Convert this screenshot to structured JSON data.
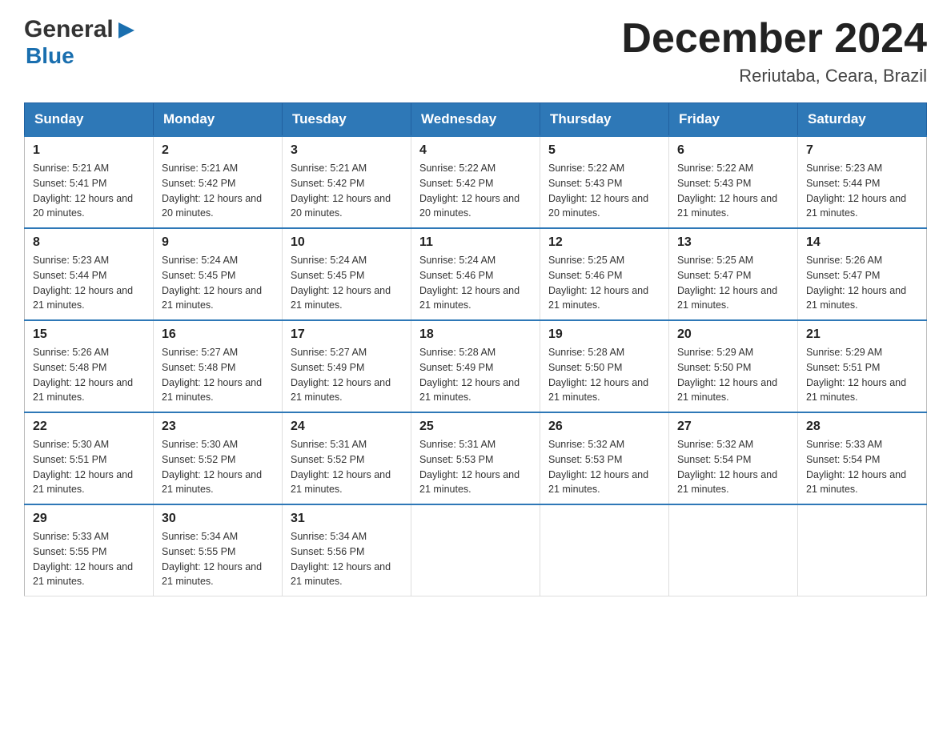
{
  "header": {
    "logo": {
      "general": "General",
      "blue": "Blue",
      "arrow_symbol": "▶"
    },
    "title": "December 2024",
    "location": "Reriutaba, Ceara, Brazil"
  },
  "calendar": {
    "days_of_week": [
      "Sunday",
      "Monday",
      "Tuesday",
      "Wednesday",
      "Thursday",
      "Friday",
      "Saturday"
    ],
    "weeks": [
      [
        {
          "day": "1",
          "sunrise": "Sunrise: 5:21 AM",
          "sunset": "Sunset: 5:41 PM",
          "daylight": "Daylight: 12 hours and 20 minutes."
        },
        {
          "day": "2",
          "sunrise": "Sunrise: 5:21 AM",
          "sunset": "Sunset: 5:42 PM",
          "daylight": "Daylight: 12 hours and 20 minutes."
        },
        {
          "day": "3",
          "sunrise": "Sunrise: 5:21 AM",
          "sunset": "Sunset: 5:42 PM",
          "daylight": "Daylight: 12 hours and 20 minutes."
        },
        {
          "day": "4",
          "sunrise": "Sunrise: 5:22 AM",
          "sunset": "Sunset: 5:42 PM",
          "daylight": "Daylight: 12 hours and 20 minutes."
        },
        {
          "day": "5",
          "sunrise": "Sunrise: 5:22 AM",
          "sunset": "Sunset: 5:43 PM",
          "daylight": "Daylight: 12 hours and 20 minutes."
        },
        {
          "day": "6",
          "sunrise": "Sunrise: 5:22 AM",
          "sunset": "Sunset: 5:43 PM",
          "daylight": "Daylight: 12 hours and 21 minutes."
        },
        {
          "day": "7",
          "sunrise": "Sunrise: 5:23 AM",
          "sunset": "Sunset: 5:44 PM",
          "daylight": "Daylight: 12 hours and 21 minutes."
        }
      ],
      [
        {
          "day": "8",
          "sunrise": "Sunrise: 5:23 AM",
          "sunset": "Sunset: 5:44 PM",
          "daylight": "Daylight: 12 hours and 21 minutes."
        },
        {
          "day": "9",
          "sunrise": "Sunrise: 5:24 AM",
          "sunset": "Sunset: 5:45 PM",
          "daylight": "Daylight: 12 hours and 21 minutes."
        },
        {
          "day": "10",
          "sunrise": "Sunrise: 5:24 AM",
          "sunset": "Sunset: 5:45 PM",
          "daylight": "Daylight: 12 hours and 21 minutes."
        },
        {
          "day": "11",
          "sunrise": "Sunrise: 5:24 AM",
          "sunset": "Sunset: 5:46 PM",
          "daylight": "Daylight: 12 hours and 21 minutes."
        },
        {
          "day": "12",
          "sunrise": "Sunrise: 5:25 AM",
          "sunset": "Sunset: 5:46 PM",
          "daylight": "Daylight: 12 hours and 21 minutes."
        },
        {
          "day": "13",
          "sunrise": "Sunrise: 5:25 AM",
          "sunset": "Sunset: 5:47 PM",
          "daylight": "Daylight: 12 hours and 21 minutes."
        },
        {
          "day": "14",
          "sunrise": "Sunrise: 5:26 AM",
          "sunset": "Sunset: 5:47 PM",
          "daylight": "Daylight: 12 hours and 21 minutes."
        }
      ],
      [
        {
          "day": "15",
          "sunrise": "Sunrise: 5:26 AM",
          "sunset": "Sunset: 5:48 PM",
          "daylight": "Daylight: 12 hours and 21 minutes."
        },
        {
          "day": "16",
          "sunrise": "Sunrise: 5:27 AM",
          "sunset": "Sunset: 5:48 PM",
          "daylight": "Daylight: 12 hours and 21 minutes."
        },
        {
          "day": "17",
          "sunrise": "Sunrise: 5:27 AM",
          "sunset": "Sunset: 5:49 PM",
          "daylight": "Daylight: 12 hours and 21 minutes."
        },
        {
          "day": "18",
          "sunrise": "Sunrise: 5:28 AM",
          "sunset": "Sunset: 5:49 PM",
          "daylight": "Daylight: 12 hours and 21 minutes."
        },
        {
          "day": "19",
          "sunrise": "Sunrise: 5:28 AM",
          "sunset": "Sunset: 5:50 PM",
          "daylight": "Daylight: 12 hours and 21 minutes."
        },
        {
          "day": "20",
          "sunrise": "Sunrise: 5:29 AM",
          "sunset": "Sunset: 5:50 PM",
          "daylight": "Daylight: 12 hours and 21 minutes."
        },
        {
          "day": "21",
          "sunrise": "Sunrise: 5:29 AM",
          "sunset": "Sunset: 5:51 PM",
          "daylight": "Daylight: 12 hours and 21 minutes."
        }
      ],
      [
        {
          "day": "22",
          "sunrise": "Sunrise: 5:30 AM",
          "sunset": "Sunset: 5:51 PM",
          "daylight": "Daylight: 12 hours and 21 minutes."
        },
        {
          "day": "23",
          "sunrise": "Sunrise: 5:30 AM",
          "sunset": "Sunset: 5:52 PM",
          "daylight": "Daylight: 12 hours and 21 minutes."
        },
        {
          "day": "24",
          "sunrise": "Sunrise: 5:31 AM",
          "sunset": "Sunset: 5:52 PM",
          "daylight": "Daylight: 12 hours and 21 minutes."
        },
        {
          "day": "25",
          "sunrise": "Sunrise: 5:31 AM",
          "sunset": "Sunset: 5:53 PM",
          "daylight": "Daylight: 12 hours and 21 minutes."
        },
        {
          "day": "26",
          "sunrise": "Sunrise: 5:32 AM",
          "sunset": "Sunset: 5:53 PM",
          "daylight": "Daylight: 12 hours and 21 minutes."
        },
        {
          "day": "27",
          "sunrise": "Sunrise: 5:32 AM",
          "sunset": "Sunset: 5:54 PM",
          "daylight": "Daylight: 12 hours and 21 minutes."
        },
        {
          "day": "28",
          "sunrise": "Sunrise: 5:33 AM",
          "sunset": "Sunset: 5:54 PM",
          "daylight": "Daylight: 12 hours and 21 minutes."
        }
      ],
      [
        {
          "day": "29",
          "sunrise": "Sunrise: 5:33 AM",
          "sunset": "Sunset: 5:55 PM",
          "daylight": "Daylight: 12 hours and 21 minutes."
        },
        {
          "day": "30",
          "sunrise": "Sunrise: 5:34 AM",
          "sunset": "Sunset: 5:55 PM",
          "daylight": "Daylight: 12 hours and 21 minutes."
        },
        {
          "day": "31",
          "sunrise": "Sunrise: 5:34 AM",
          "sunset": "Sunset: 5:56 PM",
          "daylight": "Daylight: 12 hours and 21 minutes."
        },
        null,
        null,
        null,
        null
      ]
    ]
  }
}
